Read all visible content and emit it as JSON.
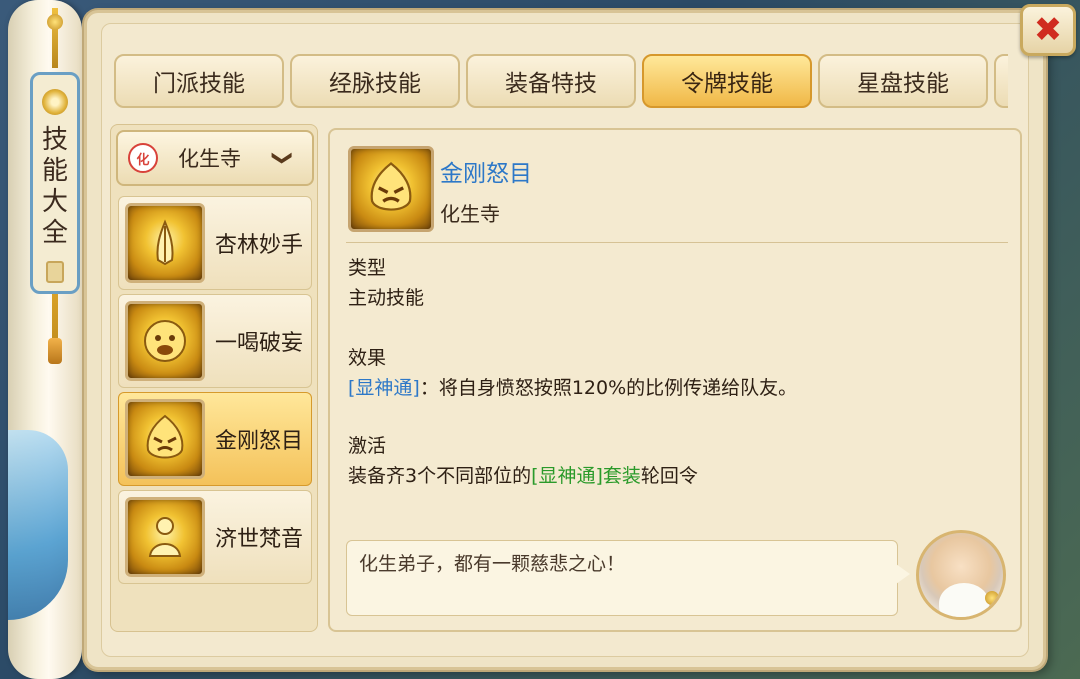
{
  "sidebar": {
    "title": "技能大全"
  },
  "window": {
    "close_label": "✖"
  },
  "tabs": [
    {
      "label": "门派技能",
      "active": false
    },
    {
      "label": "经脉技能",
      "active": false
    },
    {
      "label": "装备特技",
      "active": false
    },
    {
      "label": "令牌技能",
      "active": true
    },
    {
      "label": "星盘技能",
      "active": false
    }
  ],
  "school_selector": {
    "emblem": "化",
    "selected": "化生寺",
    "chevron": "❯"
  },
  "skills": [
    {
      "name": "杏林妙手",
      "icon": "praying-hands-icon",
      "active": false
    },
    {
      "name": "一喝破妄",
      "icon": "roaring-face-icon",
      "active": false
    },
    {
      "name": "金刚怒目",
      "icon": "angry-vajra-face-icon",
      "active": true
    },
    {
      "name": "济世梵音",
      "icon": "meditating-monk-icon",
      "active": false
    }
  ],
  "detail": {
    "name": "金刚怒目",
    "school": "化生寺",
    "type_heading": "类型",
    "type_value": "主动技能",
    "effect_heading": "效果",
    "effect_tag": "[显神通]",
    "effect_text": "：将自身愤怒按照120%的比例传递给队友。",
    "activate_heading": "激活",
    "activate_prefix": "装备齐3个不同部位的",
    "activate_set": "[显神通]套装",
    "activate_suffix": "轮回令"
  },
  "npc": {
    "quote": "化生弟子，都有一颗慈悲之心！"
  },
  "colors": {
    "accent_blue": "#2d78c8",
    "accent_green": "#2a9a2a",
    "active_tab": "#f0b847",
    "close_red": "#d02b1f"
  }
}
